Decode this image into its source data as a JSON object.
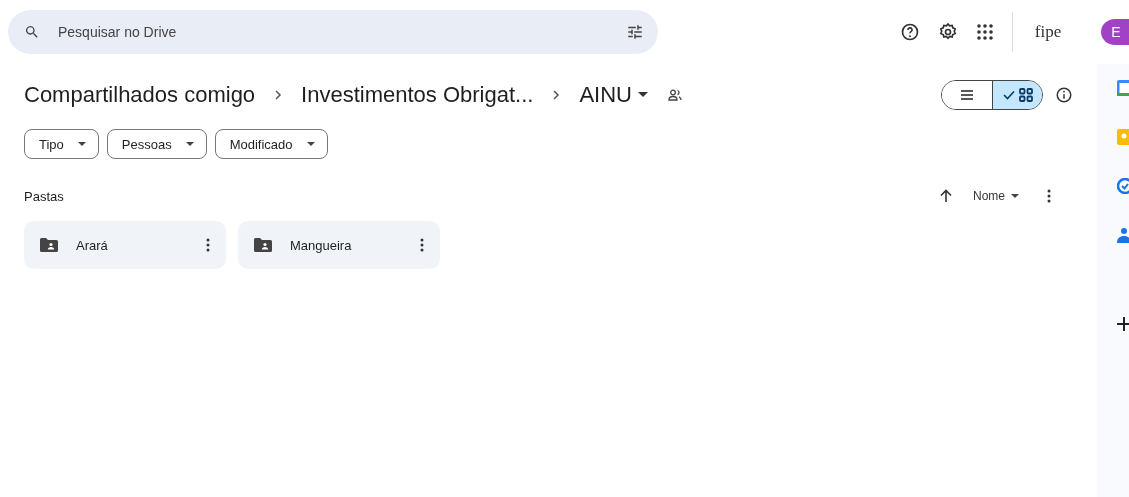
{
  "search": {
    "placeholder": "Pesquisar no Drive"
  },
  "org_logo": "fipe",
  "account": {
    "initial": "E",
    "color": "#a142c6"
  },
  "breadcrumbs": [
    {
      "label": "Compartilhados comigo"
    },
    {
      "label": "Investimentos Obrigat..."
    },
    {
      "label": "AINU",
      "current": true
    }
  ],
  "view_toggle": [
    {
      "kind": "list",
      "selected": false
    },
    {
      "kind": "grid",
      "selected": true
    }
  ],
  "filters": [
    {
      "label": "Tipo"
    },
    {
      "label": "Pessoas"
    },
    {
      "label": "Modificado"
    }
  ],
  "section_title": "Pastas",
  "sort": {
    "label": "Nome"
  },
  "folders": [
    {
      "name": "Arará"
    },
    {
      "name": "Mangueira"
    }
  ],
  "side_apps": [
    {
      "kind": "calendar"
    },
    {
      "kind": "keep"
    },
    {
      "kind": "tasks"
    },
    {
      "kind": "contacts"
    },
    {
      "kind": "add"
    }
  ]
}
